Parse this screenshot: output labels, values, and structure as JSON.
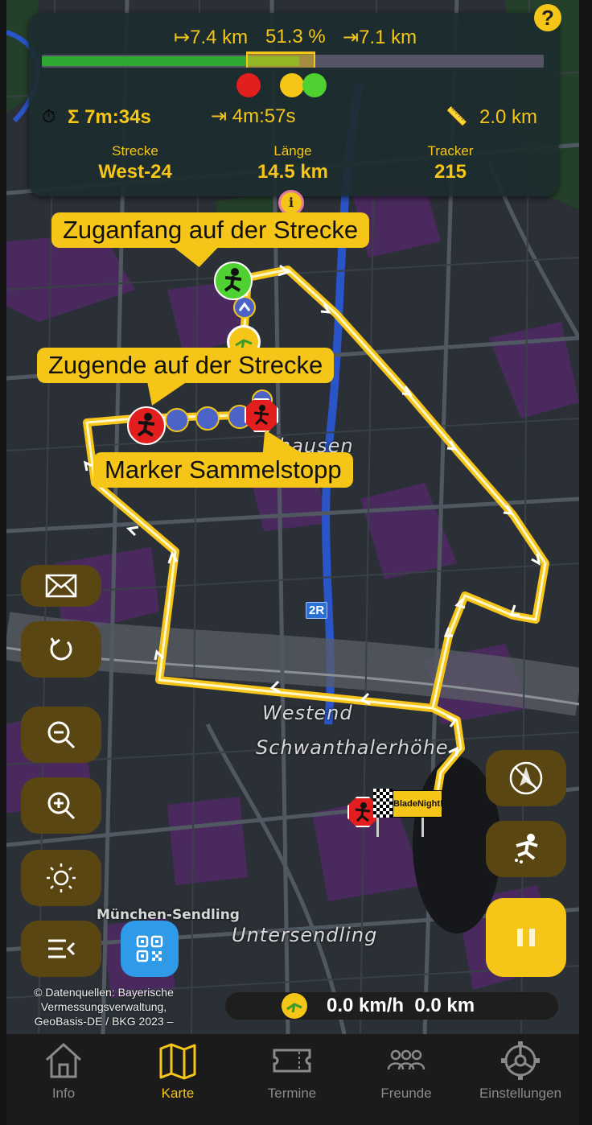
{
  "status": {
    "head_distance": "↦7.4 km",
    "progress_percent": "51.3 %",
    "tail_distance": "⇥7.1 km",
    "progress_fraction": 0.513,
    "total_time": "Σ 7m:34s",
    "eta": "⇥ 4m:57s",
    "train_length": "2.0 km",
    "route_label": "Strecke",
    "route_value": "West-24",
    "length_label": "Länge",
    "length_value": "14.5 km",
    "tracker_label": "Tracker",
    "tracker_value": "215"
  },
  "help_label": "?",
  "info_label": "i",
  "callouts": {
    "head": "Zuganfang auf der Strecke",
    "tail": "Zugende auf der Strecke",
    "stop": "Marker Sammelstopp"
  },
  "map": {
    "places": [
      "hausen",
      "Westend",
      "Schwanthalerhöhe",
      "München-Sendling",
      "Untersendling"
    ],
    "road_shield": "2R",
    "finish_sign": "BladeNight!",
    "attribution": "© Datenquellen: Bayerische Vermessungsverwaltung, GeoBasis-DE / BKG 2023 –"
  },
  "speed_bar": {
    "text": "0.0 km/h  0.0 km"
  },
  "colors": {
    "accent": "#f5c518",
    "brown": "#5a4612",
    "progress_green": "#2ea832",
    "marker_red": "#e21e1e",
    "marker_green": "#4fd132"
  },
  "tabs": [
    {
      "label": "Info",
      "icon": "home-icon"
    },
    {
      "label": "Karte",
      "icon": "map-icon",
      "active": true
    },
    {
      "label": "Termine",
      "icon": "ticket-icon"
    },
    {
      "label": "Freunde",
      "icon": "friends-icon"
    },
    {
      "label": "Einstellungen",
      "icon": "gear-icon"
    }
  ]
}
